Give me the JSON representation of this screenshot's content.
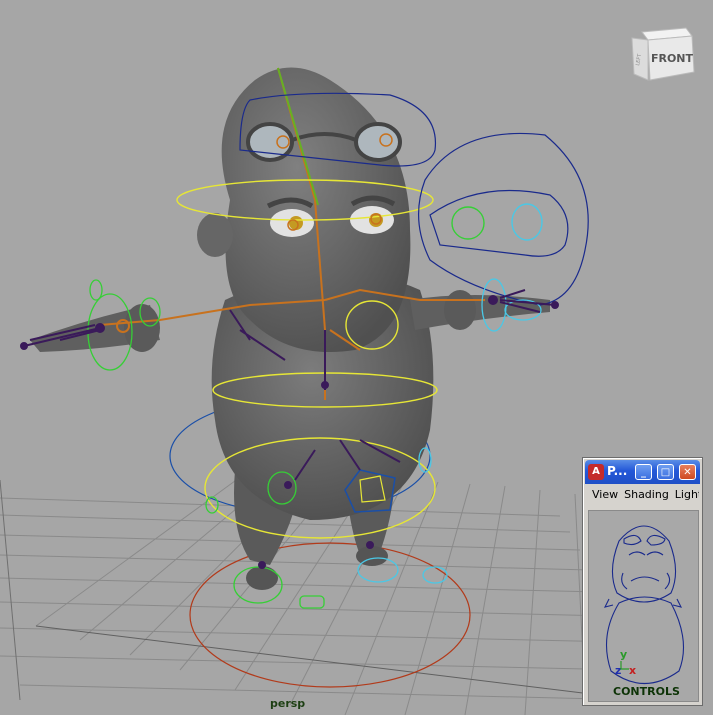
{
  "viewport": {
    "camera_label": "persp",
    "viewcube_face": "FRONT",
    "viewcube_side": "LEFT",
    "background": "#a6a6a6"
  },
  "panel": {
    "title": "P...",
    "app_icon": "maya-icon",
    "menu": [
      "View",
      "Shading",
      "Lighti"
    ],
    "controls_label": "CONTROLS",
    "axis_labels": {
      "x": "x",
      "y": "y",
      "z": "z"
    }
  },
  "colors": {
    "grid": "#8a8a8a",
    "body": "#6f6f6f",
    "yellow_ctrl": "#e6e636",
    "blue_ctrl": "#1a2a8c",
    "green_ctrl": "#36cf36",
    "cyan_ctrl": "#4ac8e6",
    "red_ctrl": "#b23a1a",
    "joint": "#3a1a5a",
    "bone": "#c8721e"
  }
}
